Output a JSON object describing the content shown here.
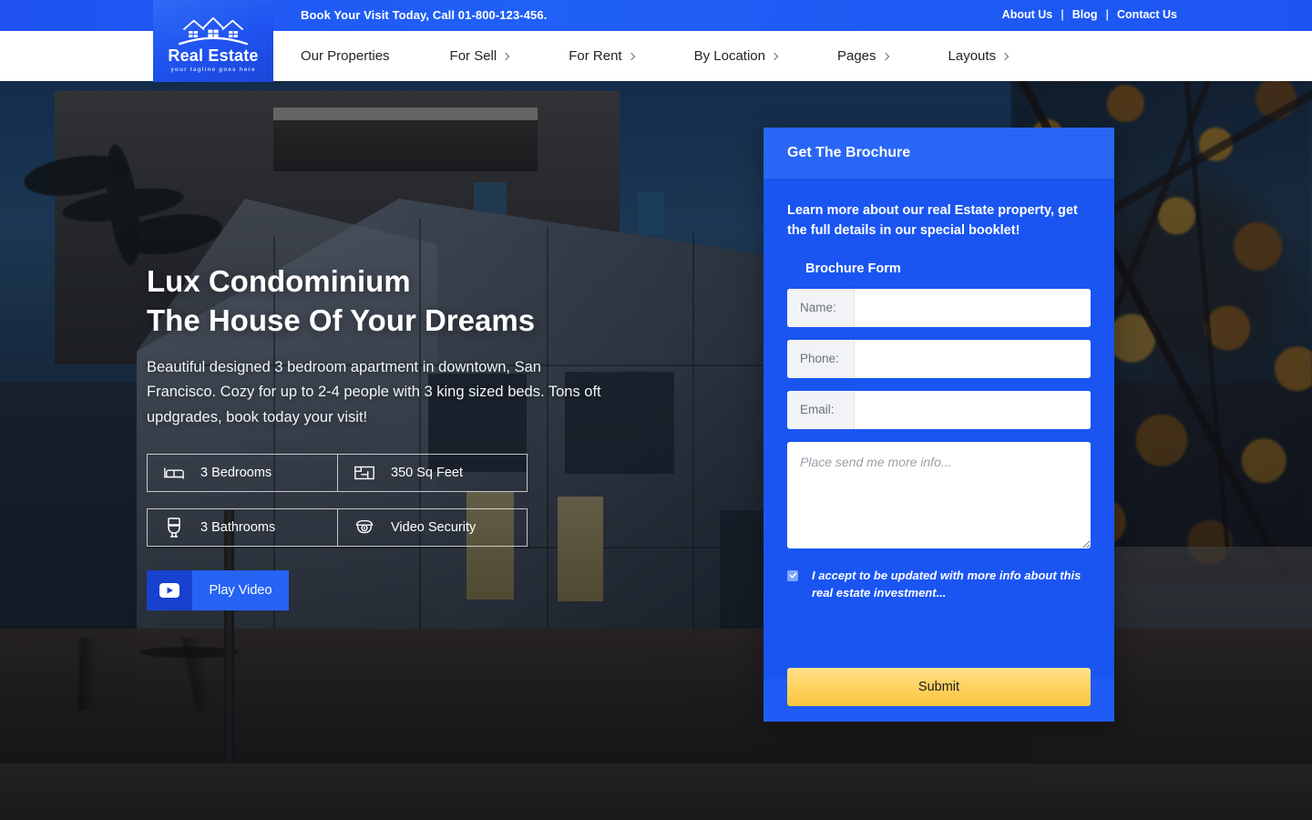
{
  "topbar": {
    "phone_text": "Book Your Visit Today, Call 01-800-123-456.",
    "links": [
      {
        "label": "About Us"
      },
      {
        "label": "Blog"
      },
      {
        "label": "Contact Us"
      }
    ],
    "separator": "|",
    "bg_color": "#1f52f0"
  },
  "logo": {
    "name": "Real Estate",
    "tagline": "your tagline goes here",
    "icon": "three-houses-icon",
    "bg_color": "#2059f2"
  },
  "nav": {
    "items": [
      {
        "label": "Our Properties",
        "has_caret": false
      },
      {
        "label": "For Sell",
        "has_caret": true
      },
      {
        "label": "For Rent",
        "has_caret": true
      },
      {
        "label": "By Location",
        "has_caret": true
      },
      {
        "label": "Pages",
        "has_caret": true
      },
      {
        "label": "Layouts",
        "has_caret": true
      }
    ],
    "bg_color": "#ffffff"
  },
  "hero": {
    "title": "Lux Condominium\nThe House Of Your Dreams",
    "subtitle": "Beautiful designed 3 bedroom apartment in downtown, San Francisco. Cozy for up to 2-4 people with 3 king sized beds. Tons oft updgrades, book today your visit!",
    "features": [
      {
        "label": "3 Bedrooms",
        "icon": "bed-icon"
      },
      {
        "label": "350 Sq Feet",
        "icon": "floor-area-icon"
      },
      {
        "label": "3 Bathrooms",
        "icon": "toilet-icon"
      },
      {
        "label": "Video Security",
        "icon": "security-camera-icon"
      }
    ],
    "play_button": {
      "label": "Play Video",
      "icon": "youtube-play-icon",
      "bg_color": "#2563f5"
    }
  },
  "brochure": {
    "header_title": "Get The Brochure",
    "intro": "Learn more about our real Estate property, get the full details in our special booklet!",
    "form_title": "Brochure Form",
    "fields": [
      {
        "label": "Name:",
        "value": "",
        "placeholder": ""
      },
      {
        "label": "Phone:",
        "value": "",
        "placeholder": ""
      },
      {
        "label": "Email:",
        "value": "",
        "placeholder": ""
      }
    ],
    "message": {
      "value": "",
      "placeholder": "Place send me more info..."
    },
    "accept": {
      "text": "I accept to be updated with more info about this real estate investment...",
      "checked": true,
      "icon": "checkmark-icon"
    },
    "submit_label": "Submit",
    "panel_color": "#1a55f2",
    "header_color": "#2a66f6",
    "submit_color": "#ffd262"
  }
}
